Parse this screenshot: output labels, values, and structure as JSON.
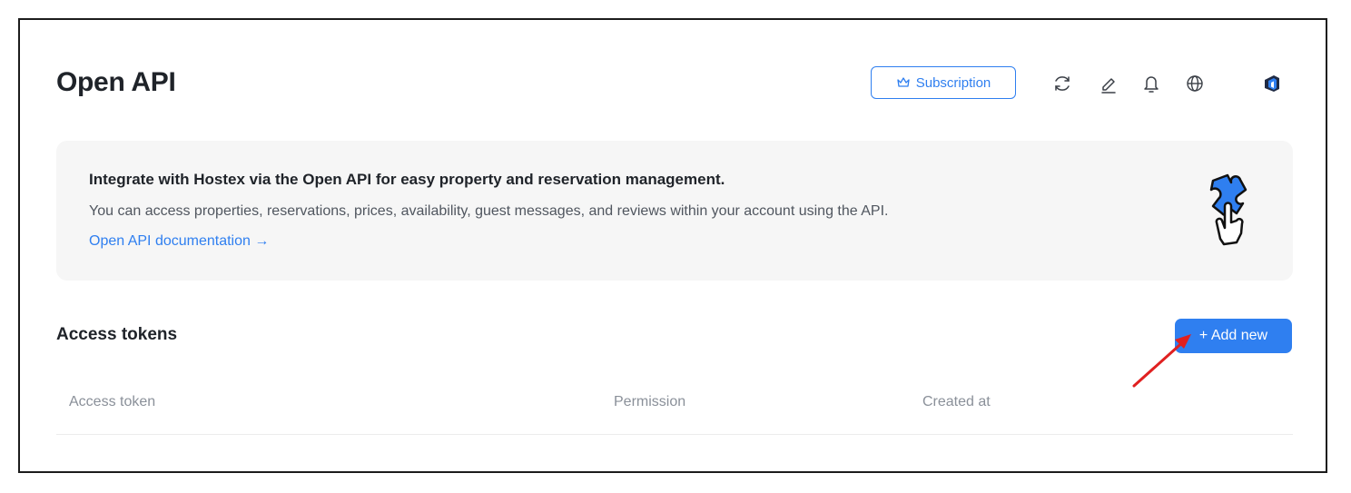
{
  "page": {
    "title": "Open API"
  },
  "header": {
    "subscription_label": "Subscription",
    "icons": [
      "refresh-icon",
      "edit-icon",
      "bell-icon",
      "globe-icon",
      "logo-icon"
    ]
  },
  "banner": {
    "title": "Integrate with Hostex via the Open API for easy property and reservation management.",
    "description": "You can access properties, reservations, prices, availability, guest messages, and reviews within your account using the API.",
    "link": "Open API documentation →",
    "illustration": "puzzle-hand-icon"
  },
  "tokens": {
    "section_title": "Access tokens",
    "add_label": "+ Add new",
    "columns": [
      "Access token",
      "Permission",
      "Created at"
    ],
    "rows": []
  },
  "colors": {
    "accent": "#2f7ff0",
    "annotation_arrow": "#e02020",
    "banner_bg": "#f6f6f6"
  }
}
